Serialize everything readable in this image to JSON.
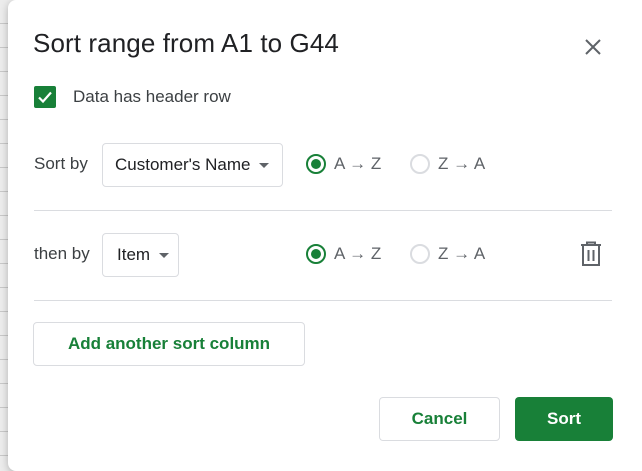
{
  "dialog": {
    "title": "Sort range from A1 to G44",
    "close_icon": "close-icon",
    "header_checkbox": {
      "label": "Data has header row",
      "checked": true,
      "icon": "checkmark-icon"
    },
    "sort_rows": [
      {
        "label": "Sort by",
        "column": "Customer's Name",
        "options": [
          {
            "label": "A → Z",
            "selected": true
          },
          {
            "label": "Z → A",
            "selected": false
          }
        ]
      },
      {
        "label": "then by",
        "column": "Item",
        "options": [
          {
            "label": "A → Z",
            "selected": true
          },
          {
            "label": "Z → A",
            "selected": false
          }
        ],
        "delete_icon": "trash-icon"
      }
    ],
    "add_button": "Add another sort column",
    "cancel_button": "Cancel",
    "sort_button": "Sort"
  },
  "colors": {
    "accent": "#188038",
    "text": "#202124",
    "secondary_text": "#5f6368",
    "border": "#dadce0"
  }
}
